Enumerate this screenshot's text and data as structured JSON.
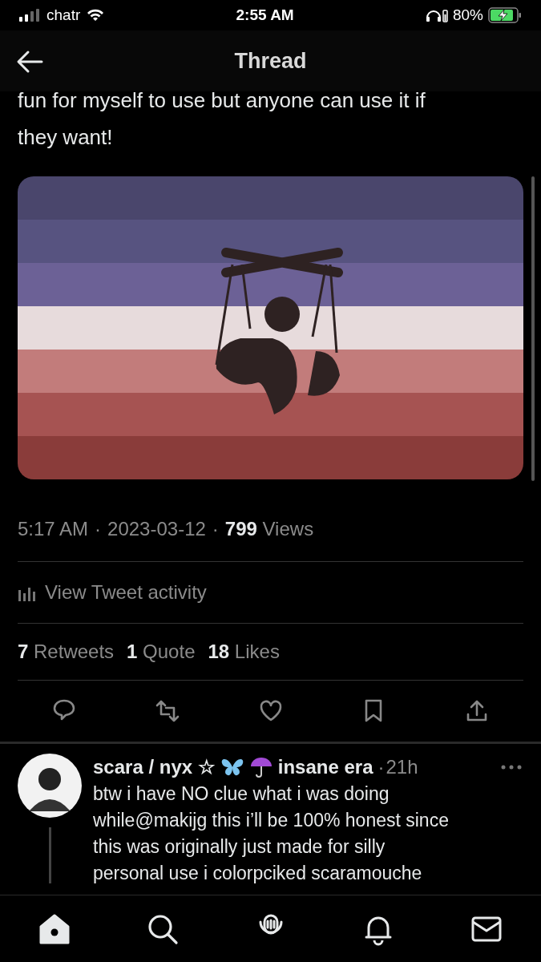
{
  "status_bar": {
    "carrier": "chatr",
    "time": "2:55 AM",
    "battery": "80%"
  },
  "header": {
    "title": "Thread"
  },
  "tweet": {
    "text_lines": [
      "fun for myself to use but anyone can use it if",
      "they want!"
    ],
    "image": {
      "kind": "picture"
    },
    "meta": {
      "time": "5:17 AM",
      "separator_1": "·",
      "date": "2023-03-12",
      "separator_2": "·",
      "views_count": "799",
      "views_label": "Views"
    },
    "activity": "View Tweet activity",
    "stats": [
      {
        "count": "7",
        "label": "Retweets"
      },
      {
        "count": "1",
        "label": "Quote"
      },
      {
        "count": "18",
        "label": "Likes"
      }
    ]
  },
  "reply": {
    "name_start": "scara / nyx ☆",
    "name_end": "insane era",
    "separator": "·",
    "time": "21h",
    "text_lines": [
      "btw i have NO clue what i was doing",
      "while@makijg this i’ll be 100% honest since",
      "this was originally just made for silly",
      "personal use i colorpciked scaramouche"
    ]
  },
  "bottom_nav": [
    {
      "kind": "home",
      "selected": true
    },
    {
      "kind": "search",
      "selected": false
    },
    {
      "kind": "spaces",
      "selected": false
    },
    {
      "kind": "notifications",
      "selected": false
    },
    {
      "kind": "messages",
      "selected": false
    }
  ]
}
